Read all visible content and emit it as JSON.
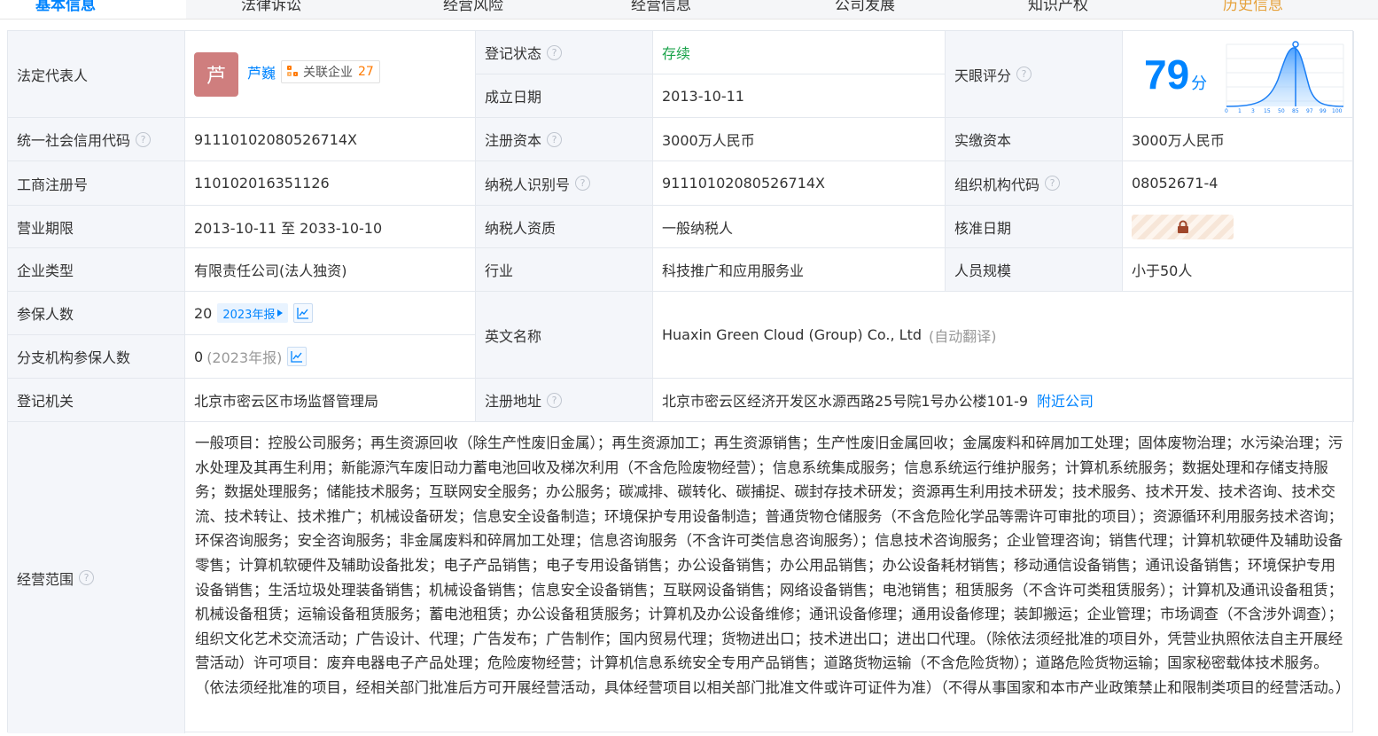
{
  "tabs": [
    {
      "label": "基本信息",
      "state": "active"
    },
    {
      "label": "法律诉讼"
    },
    {
      "label": "经营风险"
    },
    {
      "label": "经营信息"
    },
    {
      "label": "公司发展"
    },
    {
      "label": "知识产权"
    },
    {
      "label": "历史信息",
      "state": "history"
    }
  ],
  "labels": {
    "legal_rep": "法定代表人",
    "reg_status": "登记状态",
    "found_date": "成立日期",
    "tianyan_score": "天眼评分",
    "credit_code": "统一社会信用代码",
    "reg_capital": "注册资本",
    "paid_capital": "实缴资本",
    "biz_reg_no": "工商注册号",
    "taxpayer_id": "纳税人识别号",
    "org_code": "组织机构代码",
    "biz_term": "营业期限",
    "taxpayer_qual": "纳税人资质",
    "approve_date": "核准日期",
    "company_type": "企业类型",
    "industry": "行业",
    "staff_size": "人员规模",
    "insured": "参保人数",
    "english_name": "英文名称",
    "branch_insured": "分支机构参保人数",
    "reg_authority": "登记机关",
    "reg_address": "注册地址",
    "biz_scope": "经营范围"
  },
  "values": {
    "legal_rep_avatar": "芦",
    "legal_rep_name": "芦巍",
    "related_label": "关联企业",
    "related_count": "27",
    "reg_status": "存续",
    "found_date": "2013-10-11",
    "score": "79",
    "score_unit": "分",
    "score_axis": [
      "0",
      "1",
      "3",
      "15",
      "50",
      "85",
      "97",
      "99",
      "100"
    ],
    "credit_code": "91110102080526714X",
    "reg_capital": "3000万人民币",
    "paid_capital": "3000万人民币",
    "biz_reg_no": "110102016351126",
    "taxpayer_id": "91110102080526714X",
    "org_code": "08052671-4",
    "biz_term": "2013-10-11 至 2033-10-10",
    "taxpayer_qual": "一般纳税人",
    "company_type": "有限责任公司(法人独资)",
    "industry": "科技推广和应用服务业",
    "staff_size": "小于50人",
    "insured_count": "20",
    "insured_report": "2023年报",
    "english_name": "Huaxin Green Cloud (Group) Co., Ltd",
    "english_note": "(自动翻译)",
    "branch_insured": "0",
    "branch_note": "(2023年报)",
    "reg_authority": "北京市密云区市场监督管理局",
    "reg_address": "北京市密云区经济开发区水源西路25号院1号办公楼101-9",
    "nearby": "附近公司",
    "biz_scope": "一般项目：控股公司服务；再生资源回收（除生产性废旧金属）；再生资源加工；再生资源销售；生产性废旧金属回收；金属废料和碎屑加工处理；固体废物治理；水污染治理；污水处理及其再生利用；新能源汽车废旧动力蓄电池回收及梯次利用（不含危险废物经营）；信息系统集成服务；信息系统运行维护服务；计算机系统服务；数据处理和存储支持服务；数据处理服务；储能技术服务；互联网安全服务；办公服务；碳减排、碳转化、碳捕捉、碳封存技术研发；资源再生利用技术研发；技术服务、技术开发、技术咨询、技术交流、技术转让、技术推广；机械设备研发；信息安全设备制造；环境保护专用设备制造；普通货物仓储服务（不含危险化学品等需许可审批的项目）；资源循环利用服务技术咨询；环保咨询服务；安全咨询服务；非金属废料和碎屑加工处理；信息咨询服务（不含许可类信息咨询服务）；信息技术咨询服务；企业管理咨询；销售代理；计算机软硬件及辅助设备零售；计算机软硬件及辅助设备批发；电子产品销售；电子专用设备销售；办公设备销售；办公用品销售；办公设备耗材销售；移动通信设备销售；通讯设备销售；环境保护专用设备销售；生活垃圾处理装备销售；机械设备销售；信息安全设备销售；互联网设备销售；网络设备销售；电池销售；租赁服务（不含许可类租赁服务）；计算机及通讯设备租赁；机械设备租赁；运输设备租赁服务；蓄电池租赁；办公设备租赁服务；计算机及办公设备维修；通讯设备修理；通用设备修理；装卸搬运；企业管理；市场调查（不含涉外调查）；组织文化艺术交流活动；广告设计、代理；广告发布；广告制作；国内贸易代理；货物进出口；技术进出口；进出口代理。（除依法须经批准的项目外，凭营业执照依法自主开展经营活动）许可项目：废弃电器电子产品处理；危险废物经营；计算机信息系统安全专用产品销售；道路货物运输（不含危险货物）；道路危险货物运输；国家秘密载体技术服务。（依法须经批准的项目，经相关部门批准后方可开展经营活动，具体经营项目以相关部门批准文件或许可证件为准）（不得从事国家和本市产业政策禁止和限制类项目的经营活动。）"
  },
  "colors": {
    "accent": "#0084ff",
    "status_green": "#1aa34a",
    "label_bg": "#f4f6fa",
    "count_orange": "#ff7a00"
  },
  "icons": [
    "help-icon",
    "related-company-icon",
    "trend-chart-icon",
    "lock-icon",
    "triangle-right-icon"
  ]
}
